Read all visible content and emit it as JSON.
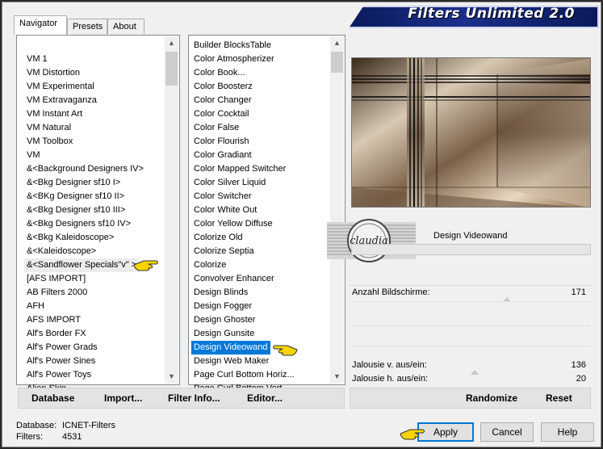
{
  "banner": {
    "title": "Filters Unlimited 2.0"
  },
  "tabs": [
    "Navigator",
    "Presets",
    "About"
  ],
  "categories": [
    "VM 1",
    "VM Distortion",
    "VM Experimental",
    "VM Extravaganza",
    "VM Instant Art",
    "VM Natural",
    "VM Toolbox",
    "VM",
    "&<Background Designers IV>",
    "&<Bkg Designer sf10 I>",
    "&<BKg Designer sf10 II>",
    "&<Bkg Designer sf10 III>",
    "&<Bkg Designers sf10 IV>",
    "&<Bkg Kaleidoscope>",
    "&<Kaleidoscope>",
    "&<Sandflower Specials\"v\" >",
    "[AFS IMPORT]",
    "AB Filters 2000",
    "AFH",
    "AFS IMPORT",
    "Alf's Border FX",
    "Alf's Power Grads",
    "Alf's Power Sines",
    "Alf's Power Toys",
    "Alien Skin"
  ],
  "filters": [
    "Builder BlocksTable",
    "Color Atmospherizer",
    "Color Book...",
    "Color Boosterz",
    "Color Changer",
    "Color Cocktail",
    "Color False",
    "Color Flourish",
    "Color Gradiant",
    "Color Mapped Switcher",
    "Color Silver Liquid",
    "Color Switcher",
    "Color White Out",
    "Color Yellow Diffuse",
    "Colorize Old",
    "Colorize Septia",
    "Colorize",
    "Convolver Enhancer",
    "Design Blinds",
    "Design Fogger",
    "Design Ghoster",
    "Design Gunsite",
    "Design Videowand",
    "Design Web Maker",
    "Page Curl Bottom Horiz...",
    "Page Curl Bottom Vert..."
  ],
  "selected_filter_index": 22,
  "highlight_category_index": 15,
  "left_buttons": {
    "database": "Database",
    "import": "Import...",
    "filter_info": "Filter Info...",
    "editor": "Editor..."
  },
  "right_buttons": {
    "randomize": "Randomize",
    "reset": "Reset"
  },
  "preview": {
    "filter_name": "Design Videowand",
    "watermark": "claudia"
  },
  "params": [
    {
      "label": "Anzahl Bildschirme:",
      "value": "171"
    },
    {
      "label": "Jalousie v. aus/ein:",
      "value": "136"
    },
    {
      "label": "Jalousie h. aus/ein:",
      "value": "20"
    }
  ],
  "status": {
    "db_label": "Database:",
    "db_value": "ICNET-Filters",
    "filters_label": "Filters:",
    "filters_value": "4531"
  },
  "dialog_buttons": {
    "apply": "Apply",
    "cancel": "Cancel",
    "help": "Help"
  }
}
